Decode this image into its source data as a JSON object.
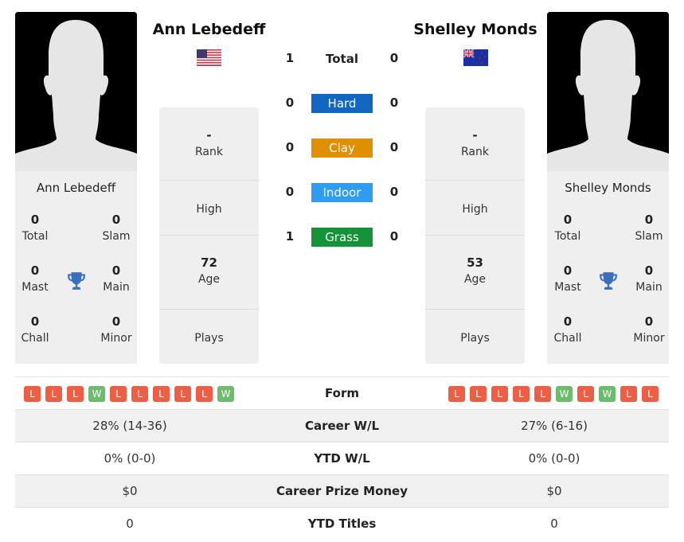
{
  "colors": {
    "hard": "#1066c1",
    "clay": "#e08f00",
    "indoor": "#2f9cf2",
    "grass": "#149338",
    "loss": "#ee5e44",
    "win": "#6dbb6d",
    "trophy": "#3a6fbe"
  },
  "player1": {
    "name": "Ann Lebedeff",
    "flag": "us-flag",
    "card_name": "Ann Lebedeff",
    "titles": {
      "total": {
        "value": "0",
        "label": "Total"
      },
      "slam": {
        "value": "0",
        "label": "Slam"
      },
      "mast": {
        "value": "0",
        "label": "Mast"
      },
      "main": {
        "value": "0",
        "label": "Main"
      },
      "chall": {
        "value": "0",
        "label": "Chall"
      },
      "minor": {
        "value": "0",
        "label": "Minor"
      }
    },
    "rank": {
      "value": "-",
      "label": "Rank"
    },
    "high": {
      "value": "",
      "label": "High"
    },
    "age": {
      "value": "72",
      "label": "Age"
    },
    "plays": {
      "value": "",
      "label": "Plays"
    },
    "form": [
      "L",
      "L",
      "L",
      "W",
      "L",
      "L",
      "L",
      "L",
      "L",
      "W"
    ],
    "career_wl": "28% (14-36)",
    "ytd_wl": "0% (0-0)",
    "prize_money": "$0",
    "ytd_titles": "0"
  },
  "player2": {
    "name": "Shelley Monds",
    "flag": "nz-flag",
    "card_name": "Shelley Monds",
    "titles": {
      "total": {
        "value": "0",
        "label": "Total"
      },
      "slam": {
        "value": "0",
        "label": "Slam"
      },
      "mast": {
        "value": "0",
        "label": "Mast"
      },
      "main": {
        "value": "0",
        "label": "Main"
      },
      "chall": {
        "value": "0",
        "label": "Chall"
      },
      "minor": {
        "value": "0",
        "label": "Minor"
      }
    },
    "rank": {
      "value": "-",
      "label": "Rank"
    },
    "high": {
      "value": "",
      "label": "High"
    },
    "age": {
      "value": "53",
      "label": "Age"
    },
    "plays": {
      "value": "",
      "label": "Plays"
    },
    "form": [
      "L",
      "L",
      "L",
      "L",
      "L",
      "W",
      "L",
      "W",
      "L",
      "L"
    ],
    "career_wl": "27% (6-16)",
    "ytd_wl": "0% (0-0)",
    "prize_money": "$0",
    "ytd_titles": "0"
  },
  "h2h": [
    {
      "label": "Total",
      "p1": "1",
      "p2": "0"
    },
    {
      "label": "Hard",
      "p1": "0",
      "p2": "0"
    },
    {
      "label": "Clay",
      "p1": "0",
      "p2": "0"
    },
    {
      "label": "Indoor",
      "p1": "0",
      "p2": "0"
    },
    {
      "label": "Grass",
      "p1": "1",
      "p2": "0"
    }
  ],
  "table_labels": {
    "form": "Form",
    "career_wl": "Career W/L",
    "ytd_wl": "YTD W/L",
    "prize_money": "Career Prize Money",
    "ytd_titles": "YTD Titles"
  }
}
